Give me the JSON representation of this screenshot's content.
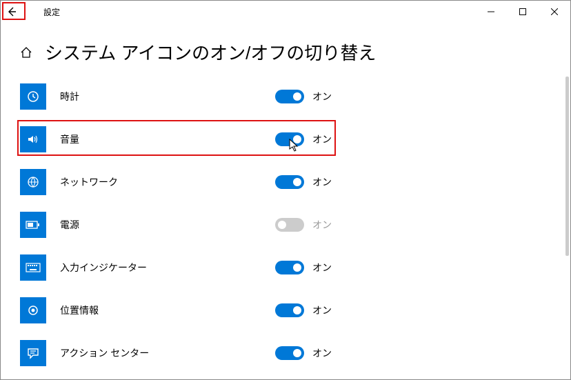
{
  "window": {
    "title": "設定"
  },
  "page": {
    "title": "システム アイコンのオン/オフの切り替え"
  },
  "state_labels": {
    "on": "オン",
    "off": "オン"
  },
  "items": [
    {
      "icon": "clock",
      "label": "時計",
      "on": true
    },
    {
      "icon": "volume",
      "label": "音量",
      "on": true,
      "highlight": true
    },
    {
      "icon": "network",
      "label": "ネットワーク",
      "on": true
    },
    {
      "icon": "power",
      "label": "電源",
      "on": false
    },
    {
      "icon": "keyboard",
      "label": "入力インジケーター",
      "on": true
    },
    {
      "icon": "location",
      "label": "位置情報",
      "on": true
    },
    {
      "icon": "action",
      "label": "アクション センター",
      "on": true
    }
  ]
}
